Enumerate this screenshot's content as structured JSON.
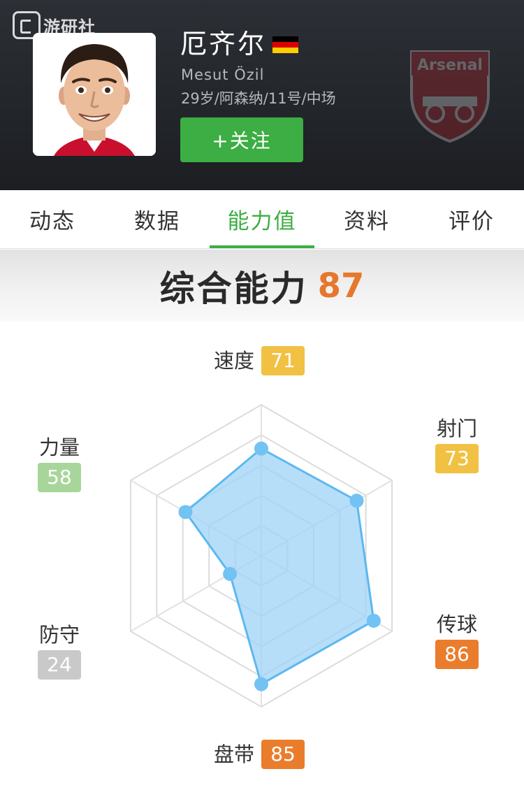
{
  "watermark": {
    "text": "游研社"
  },
  "player": {
    "name_cn": "厄齐尔",
    "name_en": "Mesut Özil",
    "meta": "29岁/阿森纳/11号/中场",
    "flag_colors": [
      "#000000",
      "#dd0000",
      "#ffce00"
    ],
    "crest_text": "Arsenal"
  },
  "follow_button": {
    "label": "+关注"
  },
  "tabs": [
    {
      "label": "动态",
      "active": false
    },
    {
      "label": "数据",
      "active": false
    },
    {
      "label": "能力值",
      "active": true
    },
    {
      "label": "资料",
      "active": false
    },
    {
      "label": "评价",
      "active": false
    }
  ],
  "overall": {
    "label": "综合能力",
    "value": "87"
  },
  "colors": {
    "accent": "#3cae43",
    "overall_value": "#e6782b",
    "radar_fill": "#9fd3f7",
    "radar_stroke": "#5cb8f0",
    "radar_point": "#72c2f3"
  },
  "chart_data": {
    "type": "radar",
    "max": 100,
    "axes": [
      {
        "label": "速度",
        "value": 71,
        "badge_color": "#f1c144"
      },
      {
        "label": "射门",
        "value": 73,
        "badge_color": "#f1c144"
      },
      {
        "label": "传球",
        "value": 86,
        "badge_color": "#ea7d2c"
      },
      {
        "label": "盘带",
        "value": 85,
        "badge_color": "#ea7d2c"
      },
      {
        "label": "防守",
        "value": 24,
        "badge_color": "#c9c9c9"
      },
      {
        "label": "力量",
        "value": 58,
        "badge_color": "#a8d59a"
      }
    ]
  }
}
